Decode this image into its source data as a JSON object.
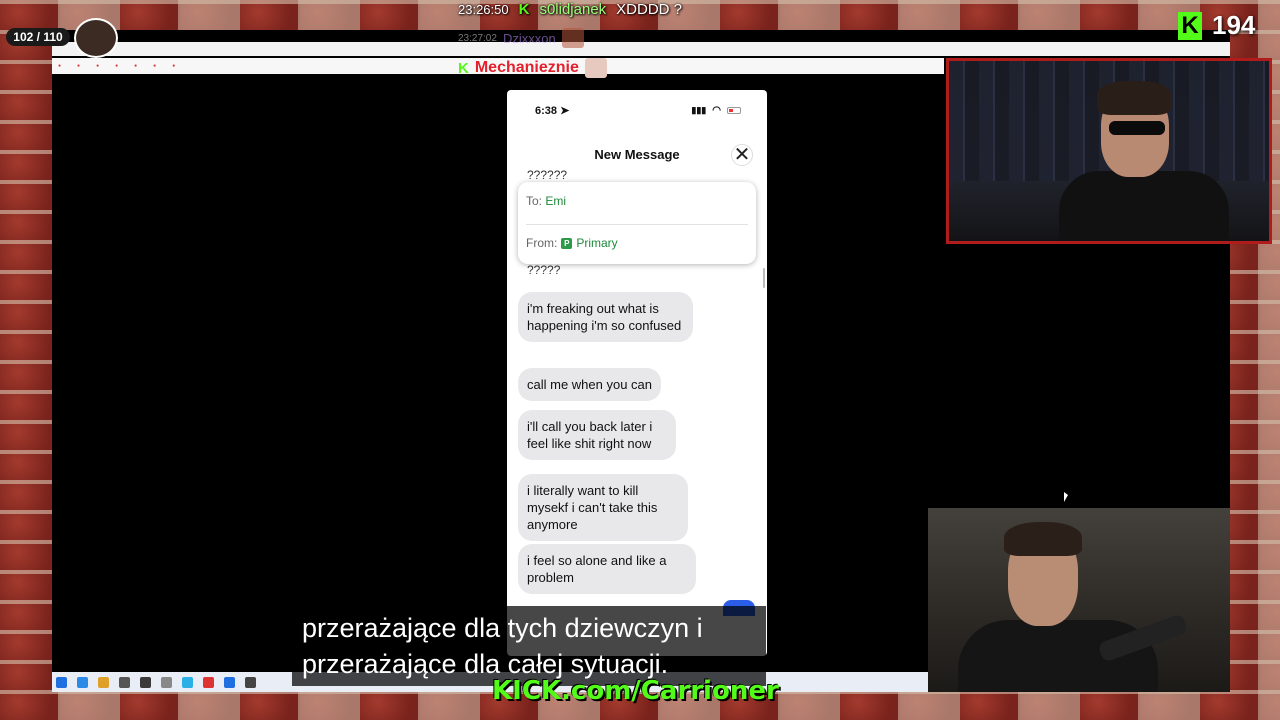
{
  "stream": {
    "counter": "102 / 110",
    "viewers": "194",
    "kick_url": "KICK.com/Carrioner",
    "subtitle": "przerażające dla tych dziewczyn i przerażające dla całej sytuacji."
  },
  "chat": [
    {
      "time": "23:26:50",
      "name": "s0lidjanek",
      "message": "XDDDD ?"
    },
    {
      "time": "23:27:02",
      "name": "Dzixxxon"
    },
    {
      "name": "Mechanieznie"
    }
  ],
  "phone": {
    "status": {
      "time": "6:38"
    },
    "sheet_title": "New Message",
    "close_symbol": "✕",
    "prev_messages": [
      "??????",
      "?????"
    ],
    "compose": {
      "to_label": "To:",
      "to_value": "Emi",
      "from_label": "From:",
      "from_value": "Primary",
      "from_badge": "P"
    },
    "messages": [
      "i'm freaking out what is happening i'm so confused",
      "call me when you can",
      "i'll call you back later i feel like shit right now",
      "i literally want to kill mysekf i can't take this anymore",
      "i feel so alone and like a problem"
    ]
  },
  "colors": {
    "kick_green": "#53fc18",
    "brand_red": "#b01c1c",
    "link_green": "#1f8a3b"
  },
  "icons": {
    "close": "close-icon",
    "location": "location-arrow-icon",
    "signal": "signal-icon",
    "wifi": "wifi-icon",
    "battery": "battery-icon"
  }
}
